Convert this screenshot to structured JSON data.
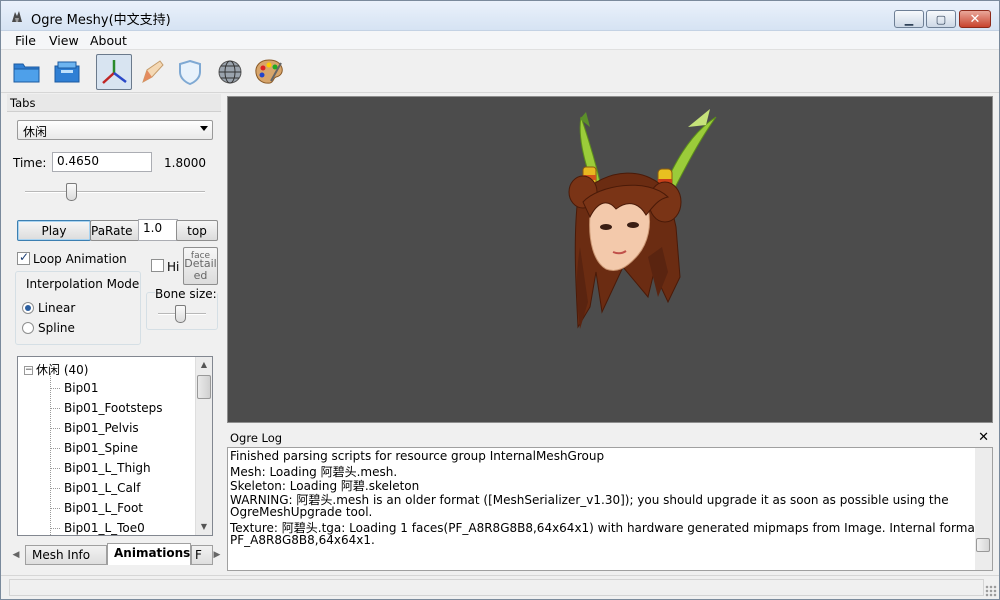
{
  "window": {
    "title": "Ogre Meshy(中文支持)"
  },
  "menu": [
    "File",
    "View",
    "About"
  ],
  "toolbar": {
    "icons": [
      "open-folder-icon",
      "open-project-icon",
      "axes-icon",
      "pencil-icon",
      "shield-icon",
      "wireframe-globe-icon",
      "palette-icon"
    ]
  },
  "tabs_panel": {
    "title": "Tabs",
    "animation_select": "休闲",
    "time_label": "Time:",
    "time_value": "0.4650",
    "time_total": "1.8000",
    "time_progress": 0.258,
    "play_label": "Play",
    "parate_label": "PaRate",
    "parate_value": "1.0",
    "stop_label": "top",
    "loop_label": "Loop Animation",
    "loop_checked": true,
    "hi_label": "Hi",
    "detail_label_1": "face",
    "detail_label_2": "Detail",
    "detail_label_3": "ed",
    "interp_title": "Interpolation Mode",
    "interp_linear": "Linear",
    "interp_spline": "Spline",
    "interp_selected": "Linear",
    "bone_size_label": "Bone size:",
    "bone_size_level": 0.45
  },
  "tree": {
    "root": "休闲 (40)",
    "items": [
      "Bip01",
      "Bip01_Footsteps",
      "Bip01_Pelvis",
      "Bip01_Spine",
      "Bip01_L_Thigh",
      "Bip01_L_Calf",
      "Bip01_L_Foot",
      "Bip01_L_Toe0"
    ]
  },
  "bottom_tabs": [
    "Mesh Info",
    "Animations",
    "F"
  ],
  "bottom_tab_selected": "Animations",
  "log": {
    "title": "Ogre Log",
    "lines": [
      "Finished parsing scripts for resource group InternalMeshGroup",
      "Mesh: Loading 阿碧头.mesh.",
      "Skeleton: Loading 阿碧.skeleton",
      "WARNING: 阿碧头.mesh is an older format ([MeshSerializer_v1.30]); you should upgrade it as soon as possible using the",
      "OgreMeshUpgrade tool.",
      "Texture: 阿碧头.tga: Loading 1 faces(PF_A8R8G8B8,64x64x1) with  hardware generated mipmaps from Image. Internal format is",
      "PF_A8R8G8B8,64x64x1."
    ]
  },
  "colors": {
    "viewport_bg": "#4c4c4c",
    "hair": "#6b2c12",
    "skin": "#f3c9ab",
    "feather": "#9bcc3a"
  }
}
